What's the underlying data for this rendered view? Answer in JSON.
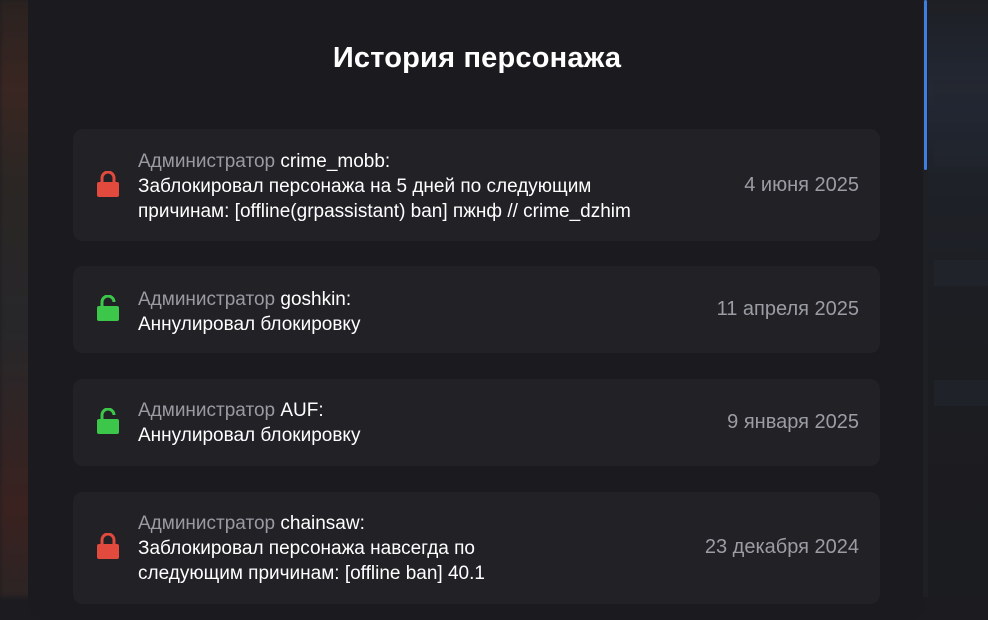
{
  "page": {
    "title": "История персонажа"
  },
  "colors": {
    "lock_red": "#e14a3c",
    "lock_green": "#3cc74a",
    "accent_blue": "#3f7de0"
  },
  "history": [
    {
      "icon": "lock-closed-icon",
      "admin_prefix": "Администратор",
      "admin_name": "crime_mobb:",
      "line1": "Заблокировал персонажа на 5 дней по следующим",
      "line2": "причинам: [offline(grpassistant) ban] пжнф // crime_dzhim",
      "date": "4 июня 2025"
    },
    {
      "icon": "lock-open-icon",
      "admin_prefix": "Администратор",
      "admin_name": "goshkin:",
      "line1": "Аннулировал блокировку",
      "date": "11 апреля 2025"
    },
    {
      "icon": "lock-open-icon",
      "admin_prefix": "Администратор",
      "admin_name": "AUF:",
      "line1": "Аннулировал блокировку",
      "date": "9 января 2025"
    },
    {
      "icon": "lock-closed-icon",
      "admin_prefix": "Администратор",
      "admin_name": "chainsaw:",
      "line1": "Заблокировал персонажа навсегда по",
      "line2": "следующим причинам: [offline ban] 40.1",
      "date": "23 декабря 2024"
    }
  ]
}
